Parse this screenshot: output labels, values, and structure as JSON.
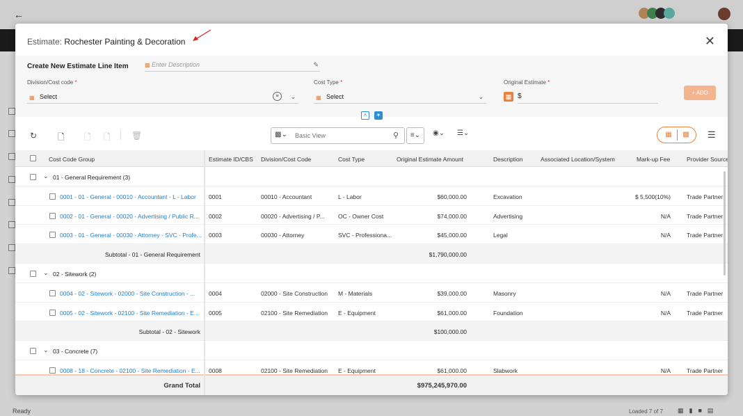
{
  "background": {
    "status": "Ready",
    "loaded": "Loaded 7 of 7"
  },
  "modal": {
    "title_prefix": "Estimate:",
    "title_name": "Rochester Painting & Decoration"
  },
  "form": {
    "create_label": "Create New Estimate Line Item",
    "description_placeholder": "Enter Description",
    "division_label": "Division/Cost code",
    "division_value": "Select",
    "cost_type_label": "Cost Type",
    "cost_type_value": "Select",
    "original_estimate_label": "Original Estimate",
    "currency": "$",
    "add_label": "+ ADD",
    "required_mark": "*"
  },
  "toolbar": {
    "search_placeholder": "Basic View"
  },
  "grid": {
    "columns": [
      "Cost Code Group",
      "Estimate ID/CBS",
      "Division/Cost Code",
      "Cost Type",
      "Original Estimate Amount",
      "Description",
      "Associated Location/System",
      "Mark-up Fee",
      "Provider Source"
    ],
    "groups": [
      {
        "label": "01 - General Requirement (3)",
        "rows": [
          {
            "name": "0001 - 01 - General - 00010 - Accountant - L - Labor",
            "id": "0001",
            "division": "00010 - Accountant",
            "type": "L - Labor",
            "amount": "$60,000.00",
            "desc": "Excavation",
            "markup": "$ 5,500(10%)",
            "provider": "Trade Partner"
          },
          {
            "name": "0002 - 01 - General - 00020 - Advertising / Public R...",
            "id": "0002",
            "division": "00020 - Advertising / P...",
            "type": "OC - Owner Cost",
            "amount": "$74,000.00",
            "desc": "Advertising",
            "markup": "N/A",
            "provider": "Trade Partner"
          },
          {
            "name": "0003 - 01 - General - 00030 - Attorney - SVC - Profe...",
            "id": "0003",
            "division": "00030 - Attorney",
            "type": "SVC - Professiona...",
            "amount": "$45,000.00",
            "desc": "Legal",
            "markup": "N/A",
            "provider": "Trade Partner"
          }
        ],
        "subtotal_label": "Subtotal - 01 - General Requirement",
        "subtotal_amount": "$1,790,000.00"
      },
      {
        "label": "02 - Sitework (2)",
        "rows": [
          {
            "name": "0004 - 02 - Sitework - 02000 - Site Construction - ...",
            "id": "0004",
            "division": "02000 - Site Construction",
            "type": "M - Materials",
            "amount": "$39,000.00",
            "desc": "Masonry",
            "markup": "N/A",
            "provider": "Trade Partner"
          },
          {
            "name": "0005 - 02 - Sitework - 02100 - Site Remediation - E...",
            "id": "0005",
            "division": "02100 - Site Remediation",
            "type": "E - Equipment",
            "amount": "$61,000.00",
            "desc": "Foundation",
            "markup": "N/A",
            "provider": "Trade Partner"
          }
        ],
        "subtotal_label": "Subtotal - 02 - Sitework",
        "subtotal_amount": "$100,000.00"
      },
      {
        "label": "03 - Concrete (7)",
        "rows": [
          {
            "name": "0008 - 18 - Concrete - 02100 - Site Remediation - E...",
            "id": "0008",
            "division": "02100 - Site Remediation",
            "type": "E - Equipment",
            "amount": "$61,000.00",
            "desc": "Slabwork",
            "markup": "N/A",
            "provider": "Trade Partner"
          }
        ]
      }
    ],
    "grand_total_label": "Grand Total",
    "grand_total_amount": "$975,245,970.00"
  }
}
